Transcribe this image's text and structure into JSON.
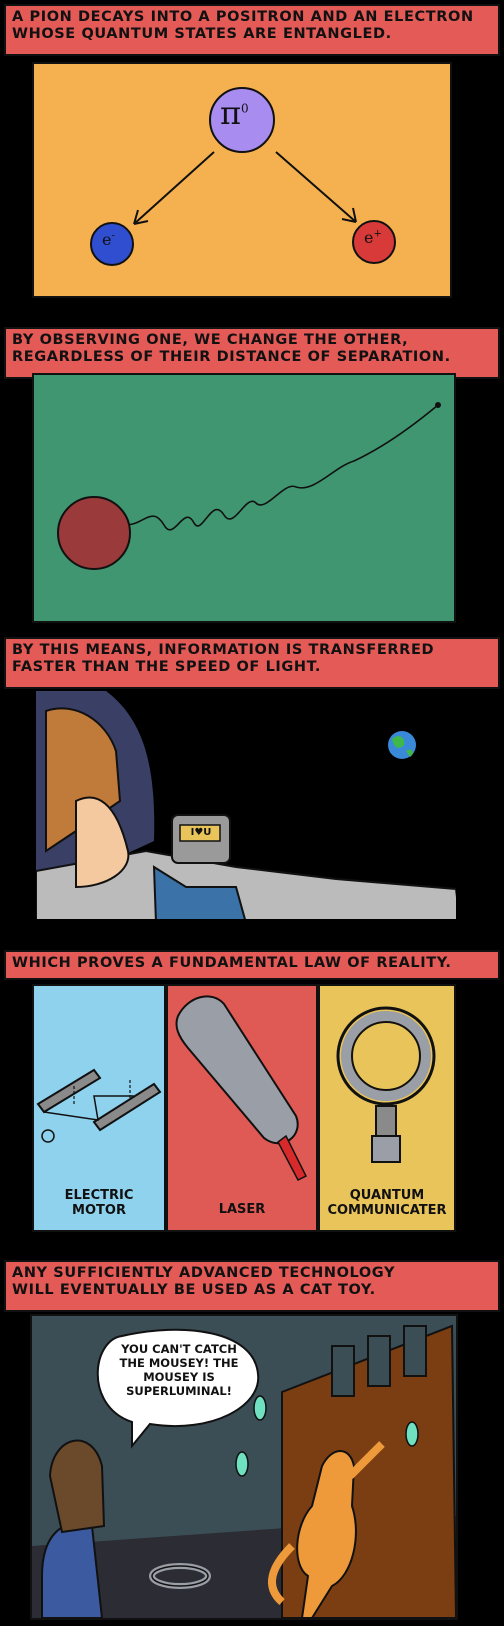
{
  "panels": [
    {
      "caption": [
        "A pion decays into a positron and an electron",
        "whose quantum states are entangled."
      ],
      "pion_symbol": "π",
      "pion_superscript": "0",
      "electron_label": "e",
      "electron_sup": "-",
      "positron_label": "e",
      "positron_sup": "+"
    },
    {
      "caption": [
        "By observing one, we change the other,",
        "regardless of their distance of separation."
      ]
    },
    {
      "caption": [
        "By this means, information is transferred",
        "faster than the speed of light."
      ],
      "device_text": "I♥U"
    },
    {
      "caption": [
        "Which proves a fundamental law of reality."
      ],
      "items": [
        {
          "label": [
            "Electric",
            "motor"
          ]
        },
        {
          "label": [
            "Laser"
          ]
        },
        {
          "label": [
            "Quantum",
            "communicater"
          ]
        }
      ]
    },
    {
      "caption": [
        "Any sufficiently advanced technology",
        "will eventually be used as a cat toy."
      ],
      "speech": [
        "You can't catch",
        "the mousey! The",
        "mousey is",
        "superluminal!"
      ]
    }
  ],
  "colors": {
    "caption_bg": "#e35a57",
    "p1_bg": "#f5b14f",
    "pion": "#a88cf0",
    "electron": "#2f4fd0",
    "positron": "#d83a3a",
    "p2_bg": "#3f9670",
    "ball": "#9a3a3a",
    "space": "#000000",
    "motor_bg": "#8fd2ee",
    "laser_bg": "#e05a55",
    "quantum_bg": "#e8c45a",
    "p5_sky": "#3b4d55",
    "cat": "#ee9a3a",
    "mouse": "#6fe0c0"
  }
}
